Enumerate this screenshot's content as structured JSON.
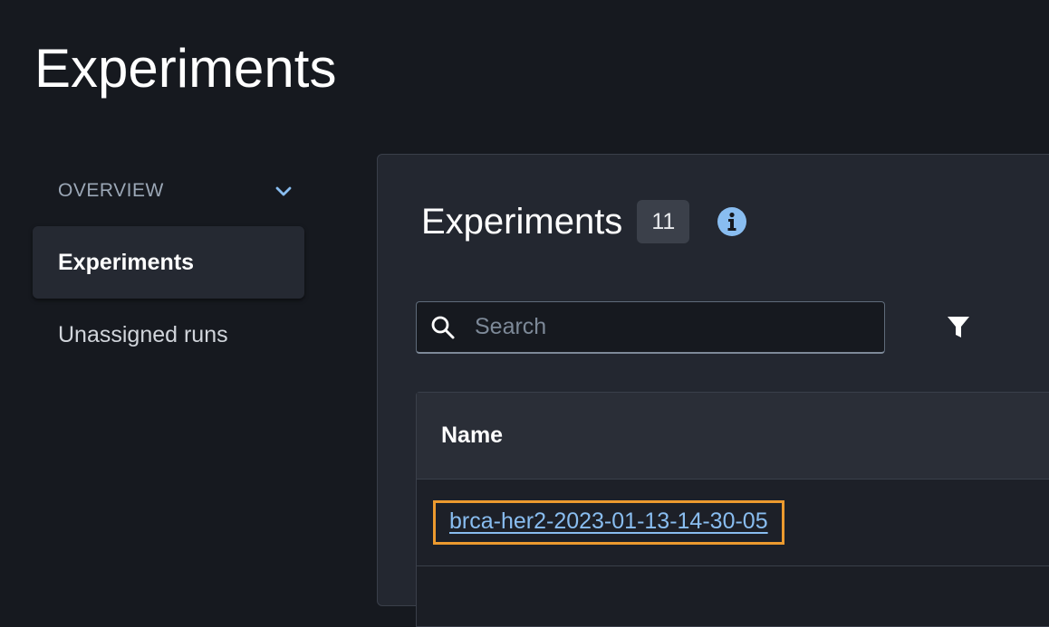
{
  "page": {
    "title": "Experiments"
  },
  "sidebar": {
    "section_label": "OVERVIEW",
    "section_icon": "chevron-down-icon",
    "items": [
      {
        "label": "Experiments",
        "active": true
      },
      {
        "label": "Unassigned runs",
        "active": false
      }
    ]
  },
  "panel": {
    "title": "Experiments",
    "count": "11",
    "info_icon": "info-icon"
  },
  "search": {
    "placeholder": "Search",
    "value": "",
    "icon": "search-icon"
  },
  "filter": {
    "icon": "filter-icon"
  },
  "table": {
    "columns": [
      "Name"
    ],
    "rows": [
      {
        "name": "brca-her2-2023-01-13-14-30-05"
      }
    ]
  },
  "colors": {
    "background": "#16191f",
    "panel": "#232730",
    "link": "#89bdf0",
    "highlight": "#ec9a2f",
    "info_icon": "#89bdf0"
  }
}
